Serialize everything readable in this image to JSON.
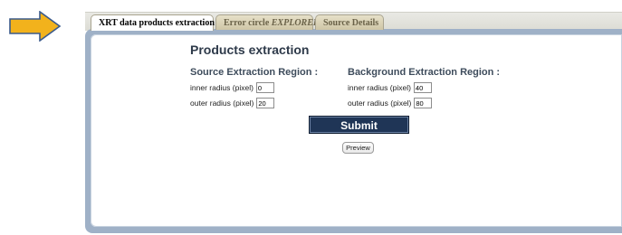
{
  "tabs": [
    {
      "label": "XRT data products extraction",
      "active": true
    },
    {
      "label_plain": "Error circle ",
      "label_em": "EXPLORER",
      "active": false
    },
    {
      "label": "Source Details",
      "active": false
    }
  ],
  "panel": {
    "title": "Products extraction",
    "source": {
      "heading": "Source Extraction Region :",
      "inner_label": "inner radius (pixel)",
      "inner_value": "0",
      "outer_label": "outer radius (pixel)",
      "outer_value": "20"
    },
    "background": {
      "heading": "Background Extraction Region :",
      "inner_label": "inner radius (pixel)",
      "inner_value": "40",
      "outer_label": "outer radius (pixel)",
      "outer_value": "80"
    },
    "submit_label": "Submit",
    "preview_label": "Preview"
  },
  "colors": {
    "arrow_fill": "#f2b21c",
    "arrow_stroke": "#3a5a8c",
    "submit_bg": "#1f3556",
    "panel_border": "#9fb1c7"
  },
  "icons": {
    "pointer": "right-arrow-icon"
  }
}
